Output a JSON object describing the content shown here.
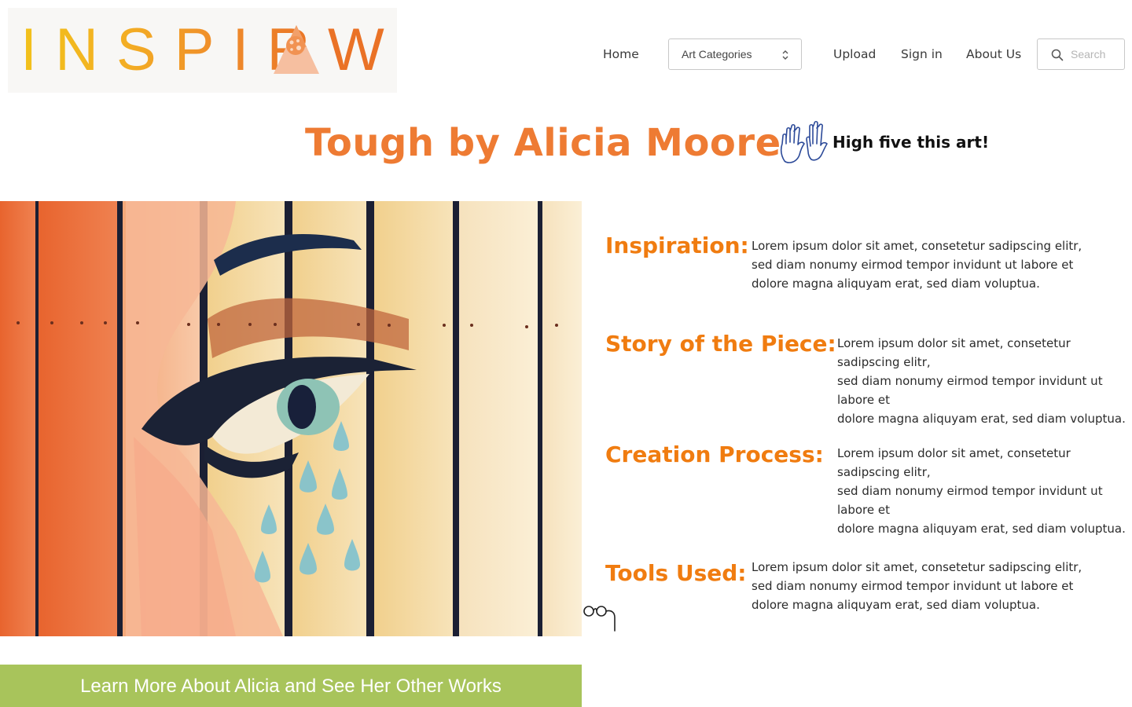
{
  "brand": {
    "logo_text_left": "INSPIR",
    "logo_text_right": "W",
    "colors": {
      "yellow": "#f2c21b",
      "orange": "#ea7226",
      "peach": "#f6b98f"
    }
  },
  "nav": {
    "home": "Home",
    "categories_select": "Art Categories",
    "upload": "Upload",
    "signin": "Sign in",
    "about": "About Us",
    "search_placeholder": "Search"
  },
  "artwork": {
    "title": "Tough by Alicia Moore",
    "high_five_label": "High five this art!",
    "high_five_icon": "raised-hands-icon"
  },
  "sections": [
    {
      "heading": "Inspiration:",
      "lines": [
        "Lorem ipsum dolor sit amet, consetetur sadipscing elitr,",
        "sed diam nonumy eirmod tempor invidunt ut labore et",
        "dolore magna aliquyam erat, sed diam voluptua."
      ]
    },
    {
      "heading": "Story of the Piece:",
      "lines": [
        "Lorem ipsum dolor sit amet, consetetur",
        "sadipscing elitr,",
        "sed diam nonumy eirmod tempor invidunt ut",
        "labore et",
        "dolore magna aliquyam erat, sed diam voluptua."
      ]
    },
    {
      "heading": "Creation Process:",
      "lines": [
        "Lorem ipsum dolor sit amet, consetetur",
        "sadipscing elitr,",
        "sed diam nonumy eirmod tempor invidunt ut",
        "labore et",
        "dolore magna aliquyam erat, sed diam voluptua."
      ]
    },
    {
      "heading": "Tools Used:",
      "lines": [
        "Lorem ipsum dolor sit amet, consetetur sadipscing elitr,",
        "sed diam nonumy eirmod tempor invidunt ut labore et",
        "dolore magna aliquyam erat, sed diam voluptua."
      ]
    }
  ],
  "cta": {
    "label": "Learn More About Alicia and See Her Other Works"
  },
  "icons": {
    "glasses": "pince-nez-glasses-icon",
    "search": "search-icon",
    "select_chevron": "updown-chevron-icon"
  }
}
